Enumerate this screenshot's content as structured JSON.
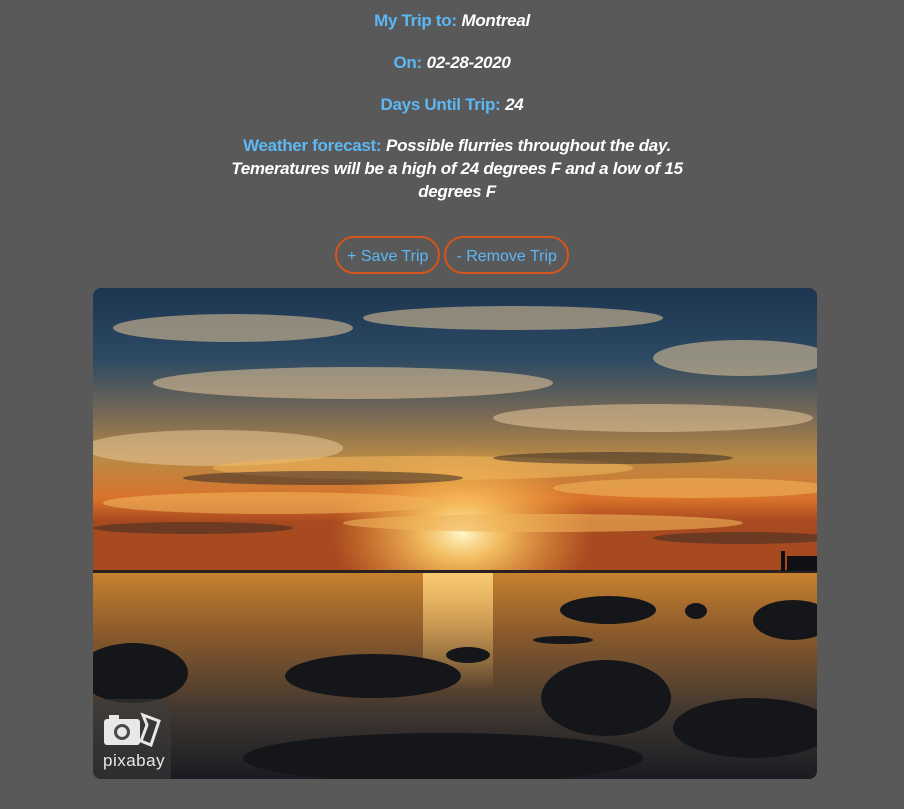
{
  "trip": {
    "destination_label": "My Trip to:",
    "destination": "Montreal",
    "date_label": "On:",
    "date": "02-28-2020",
    "days_label": "Days Until Trip:",
    "days": "24",
    "weather_label": "Weather forecast:",
    "weather": "Possible flurries throughout the day. Temeratures will be a high of 24 degrees F and a low of 15 degrees F"
  },
  "actions": {
    "save_label": "+ Save Trip",
    "remove_label": "- Remove Trip"
  },
  "photo": {
    "credit": "pixabay",
    "icon": "camera-icon"
  },
  "colors": {
    "background": "#595959",
    "label": "#5cb8f5",
    "value": "#ffffff",
    "button_border": "#d9541a"
  }
}
